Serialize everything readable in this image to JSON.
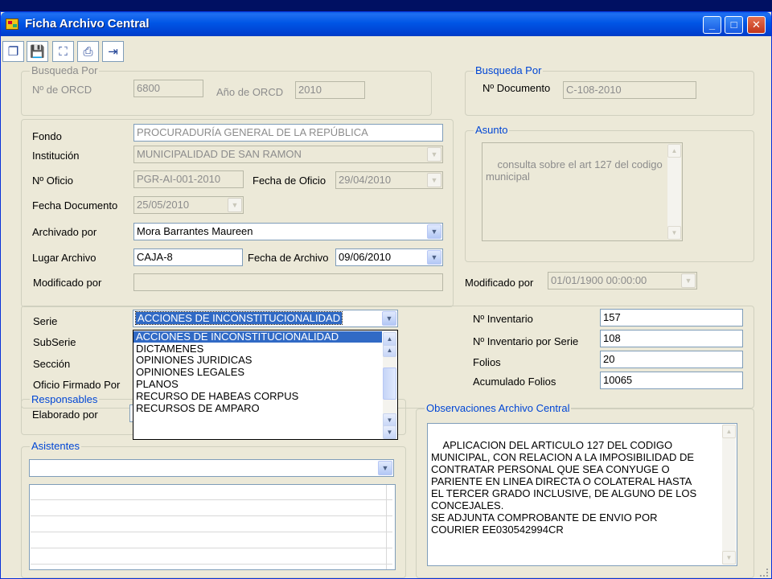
{
  "window": {
    "title": "Ficha Archivo Central",
    "controls": {
      "minimize": "_",
      "maximize": "□",
      "close": "✕"
    }
  },
  "toolbar": {
    "buttons": [
      {
        "icon": "new-document-icon",
        "glyph": "❐"
      },
      {
        "icon": "save-icon",
        "glyph": "💾"
      },
      {
        "icon": "binoculars-search-icon",
        "glyph": "⛶"
      },
      {
        "icon": "print-icon",
        "glyph": "⎙"
      },
      {
        "icon": "exit-icon",
        "glyph": "⇥"
      }
    ]
  },
  "busqueda_orcd": {
    "legend": "Busqueda Por",
    "orcd_label": "Nº de ORCD",
    "orcd_value": "6800",
    "anio_label": "Año de ORCD",
    "anio_value": "2010"
  },
  "busqueda_doc": {
    "legend": "Busqueda Por",
    "doc_label": "Nº Documento",
    "doc_value": "C-108-2010"
  },
  "ficha": {
    "fondo_label": "Fondo",
    "fondo_value": "PROCURADURÍA GENERAL DE LA REPÚBLICA",
    "institucion_label": "Institución",
    "institucion_value": "MUNICIPALIDAD DE SAN RAMON",
    "oficio_label": "Nº Oficio",
    "oficio_value": "PGR-AI-001-2010",
    "fecha_oficio_label": "Fecha de Oficio",
    "fecha_oficio_value": "29/04/2010",
    "fecha_doc_label": "Fecha Documento",
    "fecha_doc_value": "25/05/2010",
    "archivado_label": "Archivado por",
    "archivado_value": "Mora Barrantes Maureen",
    "lugar_label": "Lugar Archivo",
    "lugar_value": "CAJA-8",
    "fecha_archivo_label": "Fecha de Archivo",
    "fecha_archivo_value": "09/06/2010",
    "modificado_label": "Modificado por",
    "modificado_value": ""
  },
  "asunto": {
    "legend": "Asunto",
    "text": "consulta sobre el art 127 del codigo\nmunicipal",
    "modificado_label": "Modificado por",
    "modificado_value": "01/01/1900 00:00:00"
  },
  "clasificacion": {
    "serie_label": "Serie",
    "serie_value": "ACCIONES DE INCONSTITUCIONALIDAD",
    "subserie_label": "SubSerie",
    "seccion_label": "Sección",
    "oficio_firmado_label": "Oficio Firmado Por",
    "serie_options": [
      "ACCIONES DE INCONSTITUCIONALIDAD",
      "DICTAMENES",
      "OPINIONES JURIDICAS",
      "OPINIONES LEGALES",
      "PLANOS",
      "RECURSO DE HABEAS CORPUS",
      "RECURSOS DE AMPARO"
    ]
  },
  "inventario": {
    "inventario_label": "Nº Inventario",
    "inventario_value": "157",
    "inventario_serie_label": "Nº Inventario por Serie",
    "inventario_serie_value": "108",
    "folios_label": "Folios",
    "folios_value": "20",
    "acumulado_label": "Acumulado Folios",
    "acumulado_value": "10065"
  },
  "responsables": {
    "legend": "Responsables",
    "elaborado_label": "Elaborado por"
  },
  "asistentes": {
    "legend": "Asistentes",
    "select_value": ""
  },
  "observaciones": {
    "legend": "Observaciones Archivo Central",
    "text": "APLICACION DEL ARTICULO 127 DEL CODIGO\nMUNICIPAL, CON RELACION A LA IMPOSIBILIDAD DE\nCONTRATAR PERSONAL QUE SEA CONYUGE O\nPARIENTE EN LINEA DIRECTA O COLATERAL HASTA\nEL TERCER GRADO INCLUSIVE, DE ALGUNO DE LOS\nCONCEJALES.\nSE ADJUNTA COMPROBANTE DE ENVIO POR\nCOURIER EE030542994CR"
  }
}
